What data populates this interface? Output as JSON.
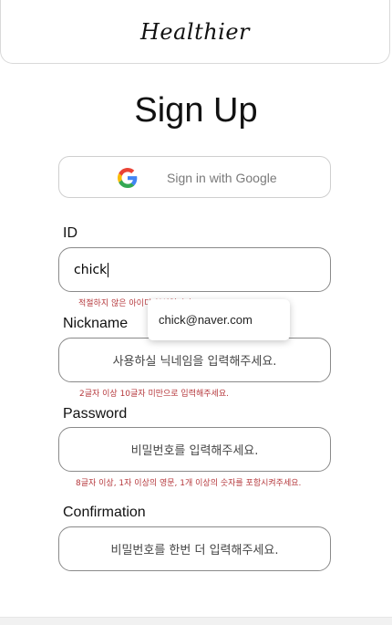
{
  "header": {
    "logo": "Healthier"
  },
  "page": {
    "title": "Sign Up"
  },
  "google": {
    "label": "Sign in with Google",
    "icon": "google-icon"
  },
  "fields": {
    "id": {
      "label": "ID",
      "value": "chick",
      "helper": "적절하지 않은 아이디 형식입니다."
    },
    "nickname": {
      "label": "Nickname",
      "placeholder": "사용하실 닉네임을 입력해주세요.",
      "helper": "2글자 이상 10글자 미만으로 입력해주세요."
    },
    "password": {
      "label": "Password",
      "placeholder": "비밀번호를 입력해주세요.",
      "helper": "8글자 이상, 1자 이상의 영문, 1개 이상의 숫자를 포함시켜주세요."
    },
    "confirmation": {
      "label": "Confirmation",
      "placeholder": "비밀번호를 한번 더 입력해주세요."
    }
  },
  "autocomplete": {
    "suggestion": "chick@naver.com"
  },
  "colors": {
    "error": "#b5383c",
    "border": "#8a8a8a"
  }
}
